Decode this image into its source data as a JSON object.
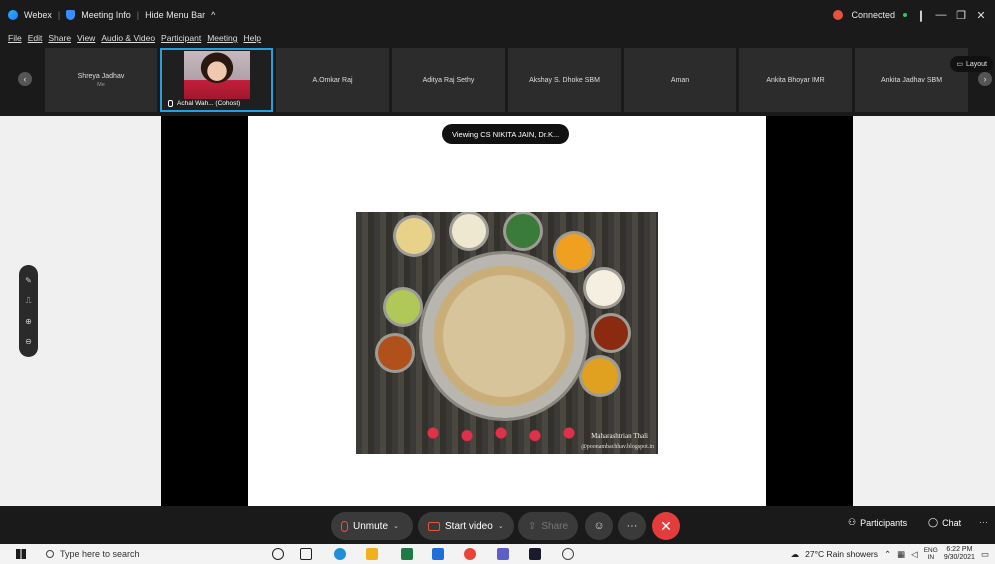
{
  "titlebar": {
    "app_name": "Webex",
    "meeting_info": "Meeting Info",
    "hide_menu": "Hide Menu Bar",
    "hide_menu_chevron": "^",
    "status": "Connected",
    "status_color": "#e5533c",
    "window_controls": [
      "—",
      "❐",
      "✕"
    ]
  },
  "menu": {
    "items": [
      "File",
      "Edit",
      "Share",
      "View",
      "Audio & Video",
      "Participant",
      "Meeting",
      "Help"
    ]
  },
  "filmstrip": {
    "prev_icon": "‹",
    "next_icon": "›",
    "layout_label": "Layout",
    "participants": [
      {
        "name": "Shreya Jadhav",
        "sub": "Me"
      },
      {
        "name": "Achal Wah... (Cohost)",
        "sub": ""
      },
      {
        "name": "A.Omkar Raj",
        "sub": ""
      },
      {
        "name": "Aditya Raj Sethy",
        "sub": ""
      },
      {
        "name": "Akshay S. Dhoke SBM",
        "sub": ""
      },
      {
        "name": "Aman",
        "sub": ""
      },
      {
        "name": "Ankita Bhoyar IMR",
        "sub": ""
      },
      {
        "name": "Ankita Jadhav SBM",
        "sub": ""
      }
    ]
  },
  "stage": {
    "viewing_label": "Viewing CS NIKITA JAIN, Dr.K...",
    "caption_title": "Maharashtrian Thali",
    "caption_url": "@poonambachhav.blogspot.in"
  },
  "zoom_tools": [
    "✎",
    "⎍",
    "⊕",
    "⊖"
  ],
  "controls": {
    "unmute": "Unmute",
    "start_video": "Start video",
    "share": "Share",
    "reactions_icon": "☺",
    "more_icon": "···",
    "end_icon": "✕",
    "participants": "Participants",
    "chat": "Chat",
    "overflow_icon": "···",
    "caret": "⌄"
  },
  "taskbar": {
    "search_placeholder": "Type here to search",
    "weather": "27°C  Rain showers",
    "lang_top": "ENG",
    "lang_bottom": "IN",
    "time": "6:22 PM",
    "date": "9/30/2021"
  }
}
